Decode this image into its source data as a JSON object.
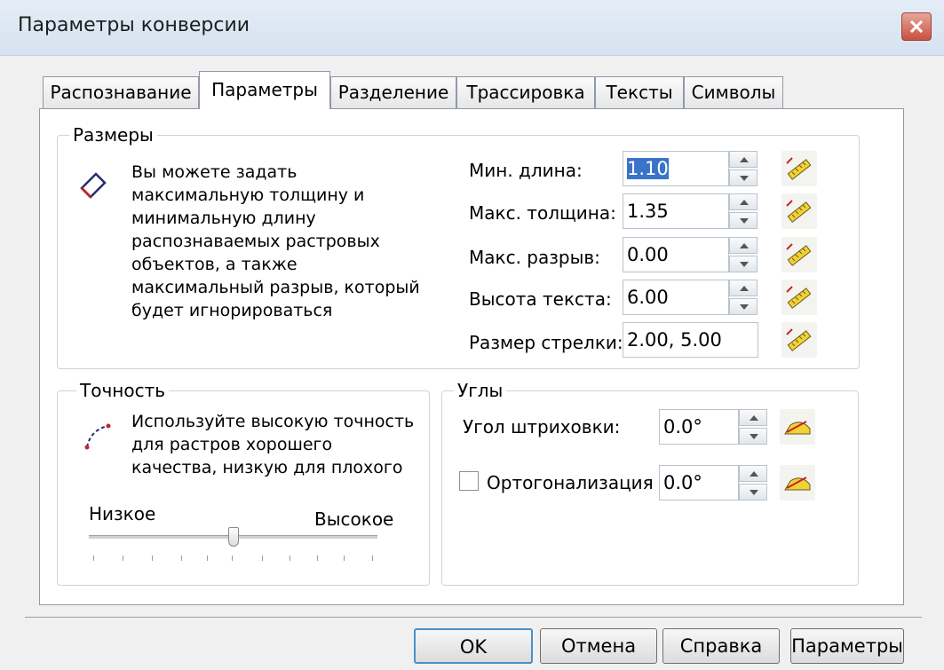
{
  "window": {
    "title": "Параметры конверсии"
  },
  "tabs": [
    {
      "label": "Распознавание"
    },
    {
      "label": "Параметры"
    },
    {
      "label": "Разделение"
    },
    {
      "label": "Трассировка"
    },
    {
      "label": "Тексты"
    },
    {
      "label": "Символы"
    }
  ],
  "sizes": {
    "legend": "Размеры",
    "description": [
      "Вы можете задать",
      "максимальную толщину и",
      "минимальную длину",
      "распознаваемых растровых",
      "объектов, а также",
      "максимальный разрыв, который",
      "будет игнорироваться"
    ],
    "fields": [
      {
        "label": "Мин. длина:",
        "value": "1.10"
      },
      {
        "label": "Макс. толщина:",
        "value": "1.35"
      },
      {
        "label": "Макс. разрыв:",
        "value": "0.00"
      },
      {
        "label": "Высота текста:",
        "value": "6.00"
      },
      {
        "label": "Размер стрелки:",
        "value": "2.00, 5.00"
      }
    ]
  },
  "accuracy": {
    "legend": "Точность",
    "description": [
      "Используйте высокую точность",
      "для растров хорошего",
      "качества, низкую для плохого"
    ],
    "low_label": "Низкое",
    "high_label": "Высокое",
    "slider_level": 0.5
  },
  "angles": {
    "legend": "Углы",
    "hatch": {
      "label": "Угол штриховки:",
      "value": "0.0°"
    },
    "ortho": {
      "label": "Ортогонализация",
      "value": "0.0°",
      "checked": false
    }
  },
  "buttons": {
    "ok": "OK",
    "cancel": "Отмена",
    "help": "Справка",
    "params": "Параметры"
  }
}
